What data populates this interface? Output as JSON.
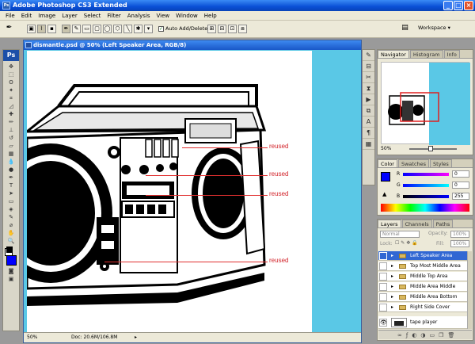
{
  "app": {
    "title": "Adobe Photoshop CS3 Extended"
  },
  "window_controls": {
    "minimize": "_",
    "maximize": "□",
    "close": "×"
  },
  "menu": [
    "File",
    "Edit",
    "Image",
    "Layer",
    "Select",
    "Filter",
    "Analysis",
    "View",
    "Window",
    "Help"
  ],
  "options_bar": {
    "auto_add_delete": "Auto Add/Delete",
    "auto_add_checked": true,
    "workspace": "Workspace"
  },
  "document": {
    "title": "dismantle.psd @ 50% (Left Speaker Area, RGB/8)",
    "zoom": "50%",
    "doc_size": "Doc: 20.6M/106.8M",
    "annotations": [
      "reused",
      "reused",
      "reused",
      "reused"
    ]
  },
  "colors": {
    "foreground": "#0000ff",
    "background": "#ffffff",
    "canvas_bg": "#5ac8e6",
    "annotation": "#d2232a"
  },
  "navigator": {
    "tabs": [
      "Navigator",
      "Histogram",
      "Info"
    ],
    "zoom": "50%"
  },
  "color_panel": {
    "tabs": [
      "Color",
      "Swatches",
      "Styles"
    ],
    "r_label": "R",
    "g_label": "G",
    "b_label": "B",
    "r": "0",
    "g": "0",
    "b": "255"
  },
  "layers_panel": {
    "tabs": [
      "Layers",
      "Channels",
      "Paths"
    ],
    "blend_mode": "Normal",
    "opacity_label": "Opacity:",
    "opacity": "100%",
    "lock_label": "Lock:",
    "fill_label": "Fill:",
    "fill": "100%",
    "layers": [
      {
        "name": "Left Speaker Area",
        "selected": true
      },
      {
        "name": "Top Most Middle Area"
      },
      {
        "name": "Middle Top Area"
      },
      {
        "name": "Middle Area Middle"
      },
      {
        "name": "Middle Area Bottom"
      },
      {
        "name": "Right Side Cover"
      }
    ],
    "base_layer": "tape player"
  }
}
